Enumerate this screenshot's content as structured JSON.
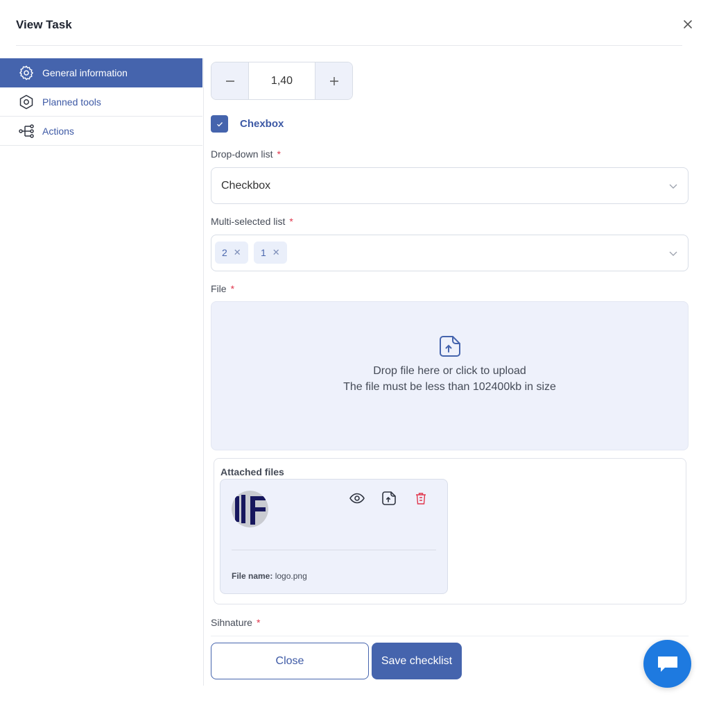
{
  "dialog": {
    "title": "View Task"
  },
  "sidebar": {
    "items": [
      {
        "label": "General information",
        "icon": "gear-icon",
        "active": true
      },
      {
        "label": "Planned tools",
        "icon": "hexagon-icon",
        "active": false
      },
      {
        "label": "Actions",
        "icon": "flow-icon",
        "active": false
      }
    ]
  },
  "stepper": {
    "value": "1,40",
    "minus": "−",
    "plus": "+"
  },
  "checkbox": {
    "label": "Chexbox",
    "checked": true
  },
  "dropdown": {
    "label": "Drop-down list",
    "required_mark": "*",
    "value": "Checkbox"
  },
  "multiselect": {
    "label": "Multi-selected list",
    "required_mark": "*",
    "tags": [
      "2",
      "1"
    ],
    "remove_glyph": "✕"
  },
  "file": {
    "label": "File",
    "required_mark": "*",
    "drop_text": "Drop file here or click to upload",
    "size_text": "The file must be less than 102400kb in size"
  },
  "attached": {
    "title": "Attached files",
    "file_name_label": "File name:",
    "file_name": "logo.png"
  },
  "signature": {
    "label": "Sihnature",
    "required_mark": "*"
  },
  "buttons": {
    "close": "Close",
    "save": "Save checklist"
  },
  "colors": {
    "accent": "#4564ad",
    "required": "#e0364c",
    "chat": "#1e7ae0",
    "delete": "#e0364c"
  }
}
